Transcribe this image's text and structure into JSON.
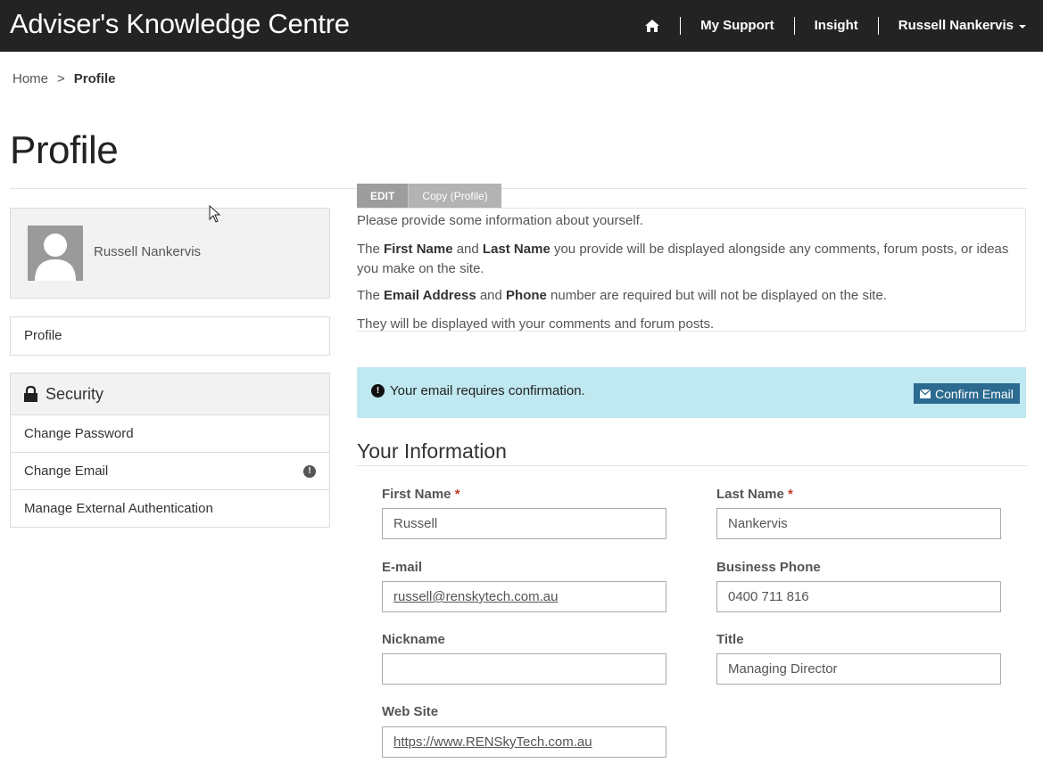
{
  "header": {
    "brand": "Adviser's Knowledge Centre",
    "nav": {
      "support": "My Support",
      "insight": "Insight",
      "user": "Russell Nankervis"
    }
  },
  "breadcrumb": {
    "home": "Home",
    "separator": ">",
    "current": "Profile"
  },
  "page": {
    "title": "Profile"
  },
  "sidebar": {
    "profile_name": "Russell Nankervis",
    "profile_link": "Profile",
    "security_heading": "Security",
    "security_items": [
      "Change Password",
      "Change Email",
      "Manage External Authentication"
    ]
  },
  "tabs": {
    "edit": "EDIT",
    "copy": "Copy (Profile)"
  },
  "intro": {
    "line1": "Please provide some information about yourself.",
    "p2_a": "The ",
    "p2_b": "First Name",
    "p2_c": " and ",
    "p2_d": "Last Name",
    "p2_e": " you provide will be displayed alongside any comments, forum posts, or ideas you make on the site.",
    "p3_a": "The ",
    "p3_b": "Email Address",
    "p3_c": " and ",
    "p3_d": "Phone",
    "p3_e": " number are required but will not be displayed on the site.",
    "line4": "They will be displayed with your comments and forum posts."
  },
  "alert": {
    "message": "Your email requires confirmation.",
    "button": "Confirm Email"
  },
  "form": {
    "heading": "Your Information",
    "first_name": {
      "label": "First Name",
      "value": "Russell"
    },
    "last_name": {
      "label": "Last Name",
      "value": "Nankervis"
    },
    "email": {
      "label": "E-mail",
      "value": "russell@renskytech.com.au"
    },
    "phone": {
      "label": "Business Phone",
      "value": "0400 711 816"
    },
    "nickname": {
      "label": "Nickname",
      "value": ""
    },
    "title": {
      "label": "Title",
      "value": "Managing Director"
    },
    "website": {
      "label": "Web Site",
      "value": "https://www.RENSkyTech.com.au"
    },
    "required_mark": "*"
  },
  "colors": {
    "header_bg": "#232323",
    "alert_bg": "#bfe8f0",
    "button_bg": "#2c6a8f"
  }
}
